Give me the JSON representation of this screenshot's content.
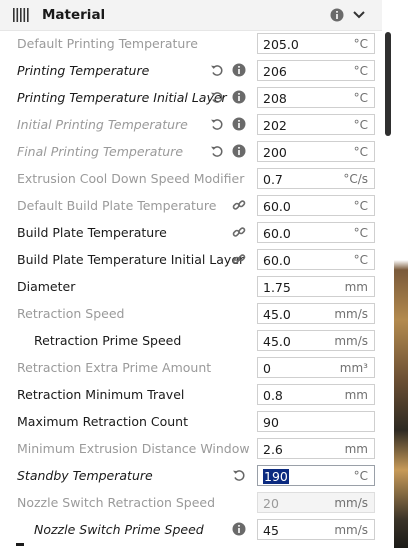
{
  "header": {
    "title": "Material"
  },
  "colors": {
    "selection": "#0b2a80",
    "scrollbar": "#2f2f2f",
    "dim_text": "#9a9a9a"
  },
  "settings": [
    {
      "label": "Default Printing Temperature",
      "value": "205.0",
      "unit": "°C",
      "style": "dim",
      "icons": []
    },
    {
      "label": "Printing Temperature",
      "value": "206",
      "unit": "°C",
      "style": "italic",
      "icons": [
        "reset-icon",
        "info-icon"
      ]
    },
    {
      "label": "Printing Temperature Initial Layer",
      "value": "208",
      "unit": "°C",
      "style": "italic",
      "icons": [
        "reset-icon",
        "info-icon"
      ]
    },
    {
      "label": "Initial Printing Temperature",
      "value": "202",
      "unit": "°C",
      "style": "italic-dim",
      "icons": [
        "reset-icon",
        "info-icon"
      ]
    },
    {
      "label": "Final Printing Temperature",
      "value": "200",
      "unit": "°C",
      "style": "italic-dim",
      "icons": [
        "reset-icon",
        "info-icon"
      ]
    },
    {
      "label": "Extrusion Cool Down Speed Modifier",
      "value": "0.7",
      "unit": "°C/s",
      "style": "dim",
      "icons": []
    },
    {
      "label": "Default Build Plate Temperature",
      "value": "60.0",
      "unit": "°C",
      "style": "dim",
      "icons": [
        "link-icon"
      ]
    },
    {
      "label": "Build Plate Temperature",
      "value": "60.0",
      "unit": "°C",
      "style": "normal",
      "icons": [
        "link-icon"
      ]
    },
    {
      "label": "Build Plate Temperature Initial Layer",
      "value": "60.0",
      "unit": "°C",
      "style": "normal",
      "icons": [
        "link-icon"
      ]
    },
    {
      "label": "Diameter",
      "value": "1.75",
      "unit": "mm",
      "style": "normal",
      "icons": []
    },
    {
      "label": "Retraction Speed",
      "value": "45.0",
      "unit": "mm/s",
      "style": "dim",
      "icons": []
    },
    {
      "label": "Retraction Prime Speed",
      "value": "45.0",
      "unit": "mm/s",
      "style": "indent",
      "icons": []
    },
    {
      "label": "Retraction Extra Prime Amount",
      "value": "0",
      "unit": "mm³",
      "style": "dim",
      "icons": []
    },
    {
      "label": "Retraction Minimum Travel",
      "value": "0.8",
      "unit": "mm",
      "style": "normal",
      "icons": []
    },
    {
      "label": "Maximum Retraction Count",
      "value": "90",
      "unit": "",
      "style": "normal",
      "icons": []
    },
    {
      "label": "Minimum Extrusion Distance Window",
      "value": "2.6",
      "unit": "mm",
      "style": "dim",
      "icons": []
    },
    {
      "label": "Standby Temperature",
      "value": "190",
      "unit": "°C",
      "style": "italic",
      "icons": [
        "reset-icon"
      ],
      "selected": true
    },
    {
      "label": "Nozzle Switch Retraction Speed",
      "value": "20",
      "unit": "mm/s",
      "style": "dim",
      "icons": [],
      "disabled": true
    },
    {
      "label": "Nozzle Switch Prime Speed",
      "value": "45",
      "unit": "mm/s",
      "style": "italic-indent",
      "icons": [
        "info-icon"
      ]
    }
  ]
}
